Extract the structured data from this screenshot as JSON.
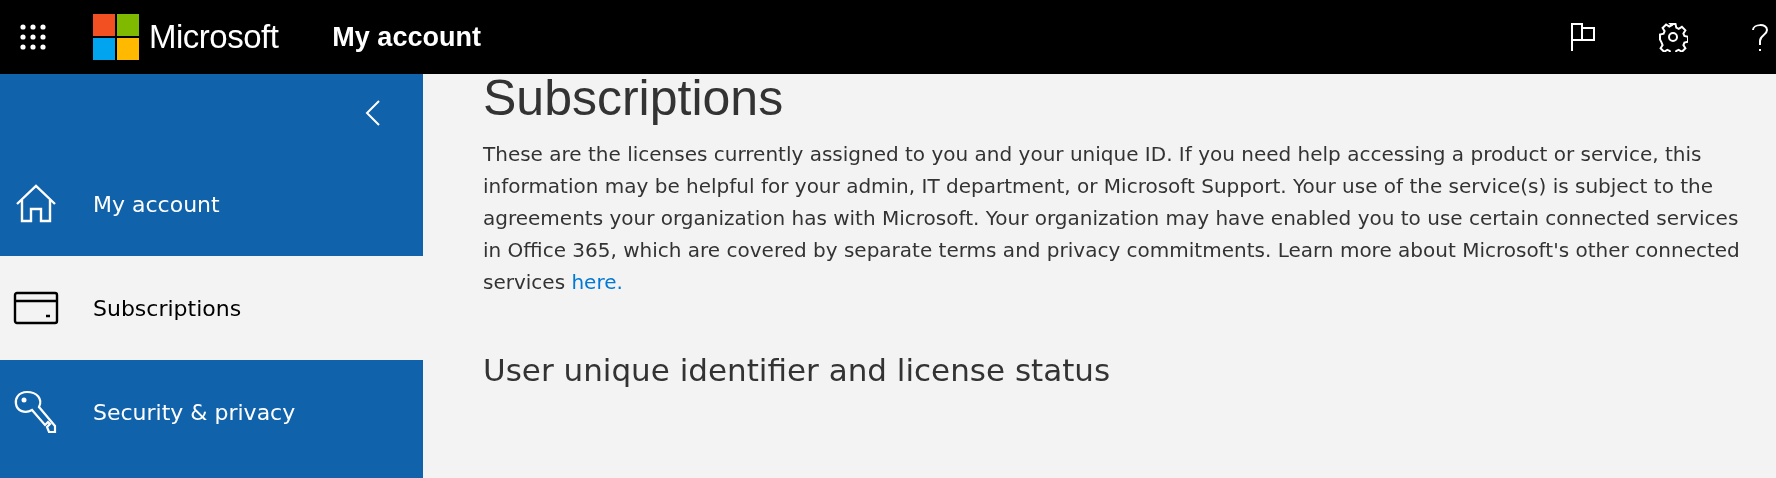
{
  "top_bar": {
    "brand": "Microsoft",
    "title": "My account"
  },
  "sidebar": {
    "items": [
      {
        "label": "My account",
        "kind": "home",
        "selected": false
      },
      {
        "label": "Subscriptions",
        "kind": "card",
        "selected": true
      },
      {
        "label": "Security & privacy",
        "kind": "key",
        "selected": false
      }
    ]
  },
  "content": {
    "heading": "Subscriptions",
    "paragraph": "These are the licenses currently assigned to you and your unique ID. If you need help accessing a product or service, this information may be helpful for your admin, IT department, or Microsoft Support. Your use of the service(s) is subject to the agreements your organization has with Microsoft. Your organization may have enabled you to use certain connected services in Office 365, which are covered by separate terms and privacy commitments. Learn more about Microsoft's other connected services",
    "link": "here.",
    "subheading": "User unique identifier and license status"
  }
}
